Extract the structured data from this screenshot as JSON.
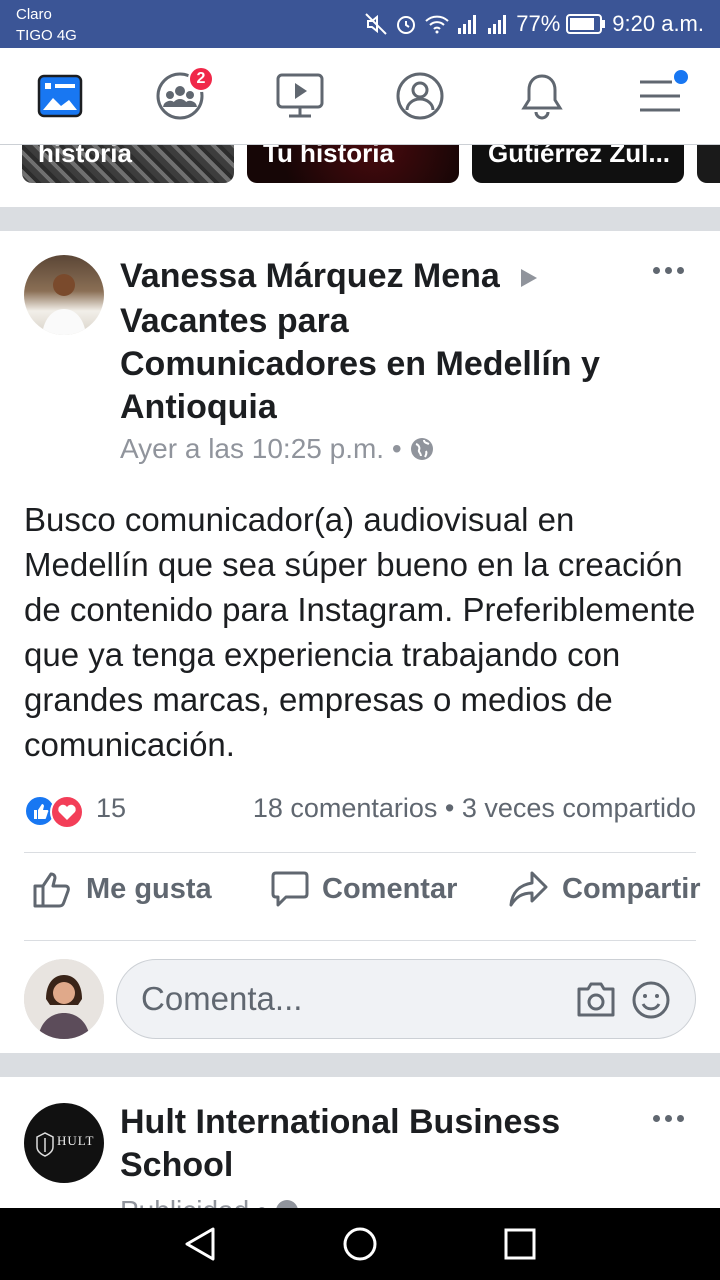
{
  "status_bar": {
    "carrier_1": "Claro",
    "carrier_2": "TIGO 4G",
    "battery": "77%",
    "time": "9:20 a.m."
  },
  "nav": {
    "friends_badge": "2",
    "icons": [
      "news-feed-icon",
      "friends-icon",
      "watch-icon",
      "profile-icon",
      "notifications-icon",
      "menu-icon"
    ]
  },
  "stories": [
    {
      "label": "historia"
    },
    {
      "label": "Tu historia"
    },
    {
      "label": "Gutiérrez Zul..."
    }
  ],
  "post1": {
    "author": "Vanessa Márquez Mena",
    "group_line1": "Vacantes para",
    "group_line2": "Comunicadores en Medellín y",
    "group_line3": "Antioquia",
    "timestamp": "Ayer a las 10:25 p.m. •",
    "text": "Busco comunicador(a) audiovisual en Medellín que sea súper bueno en la creación de contenido para Instagram. Preferiblemente que ya tenga experiencia trabajando con grandes marcas, empresas o medios de comunicación.",
    "reaction_count": "15",
    "engagement": "18 comentarios • 3 veces compartido",
    "like_label": "Me gusta",
    "comment_label": "Comentar",
    "share_label": "Compartir",
    "comment_placeholder": "Comenta..."
  },
  "post2": {
    "author_line1": "Hult International Business",
    "author_line2": "School",
    "logo_text": "HULT",
    "meta": "Publicidad •"
  },
  "colors": {
    "status_bar": "#3b5596",
    "badge": "#f02849",
    "accent": "#1877f2"
  }
}
